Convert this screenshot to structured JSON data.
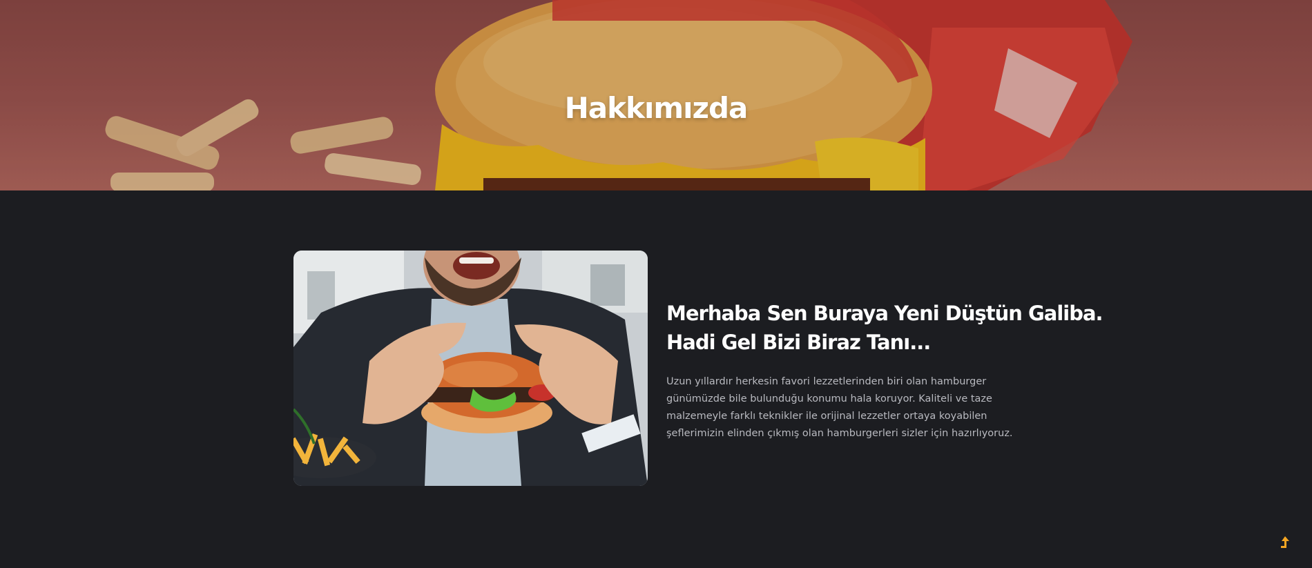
{
  "hero": {
    "title": "Hakkımızda"
  },
  "about": {
    "heading_line1": "Merhaba Sen Buraya Yeni Düştün Galiba.",
    "heading_line2": "Hadi Gel Bizi Biraz Tanı...",
    "body": "Uzun yıllardır herkesin favori lezzetlerinden biri olan hamburger günümüzde bile bulunduğu konumu hala koruyor. Kaliteli ve taze malzemeyle farklı teknikler ile orijinal lezzetler ortaya koyabilen şeflerimizin elinden çıkmış olan hamburgerleri sizler için hazırlıyoruz."
  },
  "colors": {
    "background": "#1c1d21",
    "accent": "#f5a623",
    "heading": "#ffffff",
    "body_text": "#b9bac0"
  },
  "icons": {
    "back_to_top": "arrow-up-icon"
  }
}
